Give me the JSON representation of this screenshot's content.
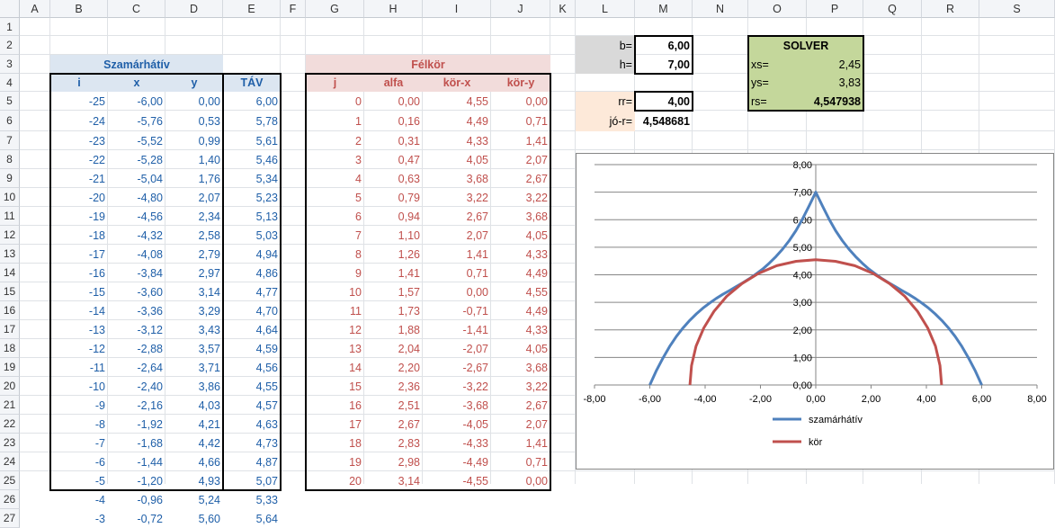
{
  "columns": [
    "A",
    "B",
    "C",
    "D",
    "E",
    "F",
    "G",
    "H",
    "I",
    "J",
    "K",
    "L",
    "M",
    "N",
    "O",
    "P",
    "Q",
    "R",
    "S"
  ],
  "rows": [
    "1",
    "2",
    "3",
    "4",
    "5",
    "6",
    "7",
    "8",
    "9",
    "10",
    "11",
    "12",
    "13",
    "14",
    "15",
    "16",
    "17",
    "18",
    "19",
    "20",
    "21",
    "22",
    "23",
    "24",
    "25",
    "26",
    "27"
  ],
  "szamarhativ": {
    "title": "Szamárhátív",
    "headers": [
      "i",
      "x",
      "y"
    ],
    "tav_header": "TÁV",
    "rows": [
      [
        "-25",
        "-6,00",
        "0,00",
        "6,00"
      ],
      [
        "-24",
        "-5,76",
        "0,53",
        "5,78"
      ],
      [
        "-23",
        "-5,52",
        "0,99",
        "5,61"
      ],
      [
        "-22",
        "-5,28",
        "1,40",
        "5,46"
      ],
      [
        "-21",
        "-5,04",
        "1,76",
        "5,34"
      ],
      [
        "-20",
        "-4,80",
        "2,07",
        "5,23"
      ],
      [
        "-19",
        "-4,56",
        "2,34",
        "5,13"
      ],
      [
        "-18",
        "-4,32",
        "2,58",
        "5,03"
      ],
      [
        "-17",
        "-4,08",
        "2,79",
        "4,94"
      ],
      [
        "-16",
        "-3,84",
        "2,97",
        "4,86"
      ],
      [
        "-15",
        "-3,60",
        "3,14",
        "4,77"
      ],
      [
        "-14",
        "-3,36",
        "3,29",
        "4,70"
      ],
      [
        "-13",
        "-3,12",
        "3,43",
        "4,64"
      ],
      [
        "-12",
        "-2,88",
        "3,57",
        "4,59"
      ],
      [
        "-11",
        "-2,64",
        "3,71",
        "4,56"
      ],
      [
        "-10",
        "-2,40",
        "3,86",
        "4,55"
      ],
      [
        "-9",
        "-2,16",
        "4,03",
        "4,57"
      ],
      [
        "-8",
        "-1,92",
        "4,21",
        "4,63"
      ],
      [
        "-7",
        "-1,68",
        "4,42",
        "4,73"
      ],
      [
        "-6",
        "-1,44",
        "4,66",
        "4,87"
      ],
      [
        "-5",
        "-1,20",
        "4,93",
        "5,07"
      ],
      [
        "-4",
        "-0,96",
        "5,24",
        "5,33"
      ],
      [
        "-3",
        "-0,72",
        "5,60",
        "5,64"
      ]
    ]
  },
  "felkor": {
    "title": "Félkör",
    "headers": [
      "j",
      "alfa",
      "kör-x",
      "kör-y"
    ],
    "rows": [
      [
        "0",
        "0,00",
        "4,55",
        "0,00"
      ],
      [
        "1",
        "0,16",
        "4,49",
        "0,71"
      ],
      [
        "2",
        "0,31",
        "4,33",
        "1,41"
      ],
      [
        "3",
        "0,47",
        "4,05",
        "2,07"
      ],
      [
        "4",
        "0,63",
        "3,68",
        "2,67"
      ],
      [
        "5",
        "0,79",
        "3,22",
        "3,22"
      ],
      [
        "6",
        "0,94",
        "2,67",
        "3,68"
      ],
      [
        "7",
        "1,10",
        "2,07",
        "4,05"
      ],
      [
        "8",
        "1,26",
        "1,41",
        "4,33"
      ],
      [
        "9",
        "1,41",
        "0,71",
        "4,49"
      ],
      [
        "10",
        "1,57",
        "0,00",
        "4,55"
      ],
      [
        "11",
        "1,73",
        "-0,71",
        "4,49"
      ],
      [
        "12",
        "1,88",
        "-1,41",
        "4,33"
      ],
      [
        "13",
        "2,04",
        "-2,07",
        "4,05"
      ],
      [
        "14",
        "2,20",
        "-2,67",
        "3,68"
      ],
      [
        "15",
        "2,36",
        "-3,22",
        "3,22"
      ],
      [
        "16",
        "2,51",
        "-3,68",
        "2,67"
      ],
      [
        "17",
        "2,67",
        "-4,05",
        "2,07"
      ],
      [
        "18",
        "2,83",
        "-4,33",
        "1,41"
      ],
      [
        "19",
        "2,98",
        "-4,49",
        "0,71"
      ],
      [
        "20",
        "3,14",
        "-4,55",
        "0,00"
      ]
    ]
  },
  "params": {
    "b_label": "b=",
    "b_value": "6,00",
    "h_label": "h=",
    "h_value": "7,00",
    "rr_label": "rr=",
    "rr_value": "4,00",
    "jor_label": "jó-r=",
    "jor_value": "4,548681"
  },
  "solver": {
    "title": "SOLVER",
    "xs_label": "xs=",
    "xs_value": "2,45",
    "ys_label": "ys=",
    "ys_value": "3,83",
    "rs_label": "rs=",
    "rs_value": "4,547938"
  },
  "colors": {
    "header_blue_bg": "#dce6f1",
    "header_red_bg": "#f2dcdb",
    "param_gray": "#d9d9d9",
    "param_orange": "#fde9d9",
    "solver_green": "#c4d79b",
    "series_blue": "#4f81bd",
    "series_red": "#c0504d"
  },
  "chart_data": {
    "type": "scatter",
    "xlim": [
      -8,
      8
    ],
    "ylim": [
      0,
      8
    ],
    "x_ticks": [
      "-8,00",
      "-6,00",
      "-4,00",
      "-2,00",
      "0,00",
      "2,00",
      "4,00",
      "6,00",
      "8,00"
    ],
    "y_ticks": [
      "0,00",
      "1,00",
      "2,00",
      "3,00",
      "4,00",
      "5,00",
      "6,00",
      "7,00",
      "8,00"
    ],
    "grid": true,
    "legend_position": "bottom",
    "series": [
      {
        "name": "szamárhátív",
        "color": "#4f81bd",
        "x": [
          -6.0,
          -5.76,
          -5.52,
          -5.28,
          -5.04,
          -4.8,
          -4.56,
          -4.32,
          -4.08,
          -3.84,
          -3.6,
          -3.36,
          -3.12,
          -2.88,
          -2.64,
          -2.4,
          -2.16,
          -1.92,
          -1.68,
          -1.44,
          -1.2,
          -0.96,
          -0.72,
          -0.48,
          -0.24,
          0.0,
          0.24,
          0.48,
          0.72,
          0.96,
          1.2,
          1.44,
          1.68,
          1.92,
          2.16,
          2.4,
          2.64,
          2.88,
          3.12,
          3.36,
          3.6,
          3.84,
          4.08,
          4.32,
          4.56,
          4.8,
          5.04,
          5.28,
          5.52,
          5.76,
          6.0
        ],
        "y": [
          0.0,
          0.53,
          0.99,
          1.4,
          1.76,
          2.07,
          2.34,
          2.58,
          2.79,
          2.97,
          3.14,
          3.29,
          3.43,
          3.57,
          3.71,
          3.86,
          4.03,
          4.21,
          4.42,
          4.66,
          4.93,
          5.24,
          5.6,
          6.02,
          6.5,
          7.0,
          6.5,
          6.02,
          5.6,
          5.24,
          4.93,
          4.66,
          4.42,
          4.21,
          4.03,
          3.86,
          3.71,
          3.57,
          3.43,
          3.29,
          3.14,
          2.97,
          2.79,
          2.58,
          2.34,
          2.07,
          1.76,
          1.4,
          0.99,
          0.53,
          0.0
        ]
      },
      {
        "name": "kör",
        "color": "#c0504d",
        "x": [
          4.55,
          4.49,
          4.33,
          4.05,
          3.68,
          3.22,
          2.67,
          2.07,
          1.41,
          0.71,
          0.0,
          -0.71,
          -1.41,
          -2.07,
          -2.67,
          -3.22,
          -3.68,
          -4.05,
          -4.33,
          -4.49,
          -4.55
        ],
        "y": [
          0.0,
          0.71,
          1.41,
          2.07,
          2.67,
          3.22,
          3.68,
          4.05,
          4.33,
          4.49,
          4.55,
          4.49,
          4.33,
          4.05,
          3.68,
          3.22,
          2.67,
          2.07,
          1.41,
          0.71,
          0.0
        ]
      }
    ]
  }
}
